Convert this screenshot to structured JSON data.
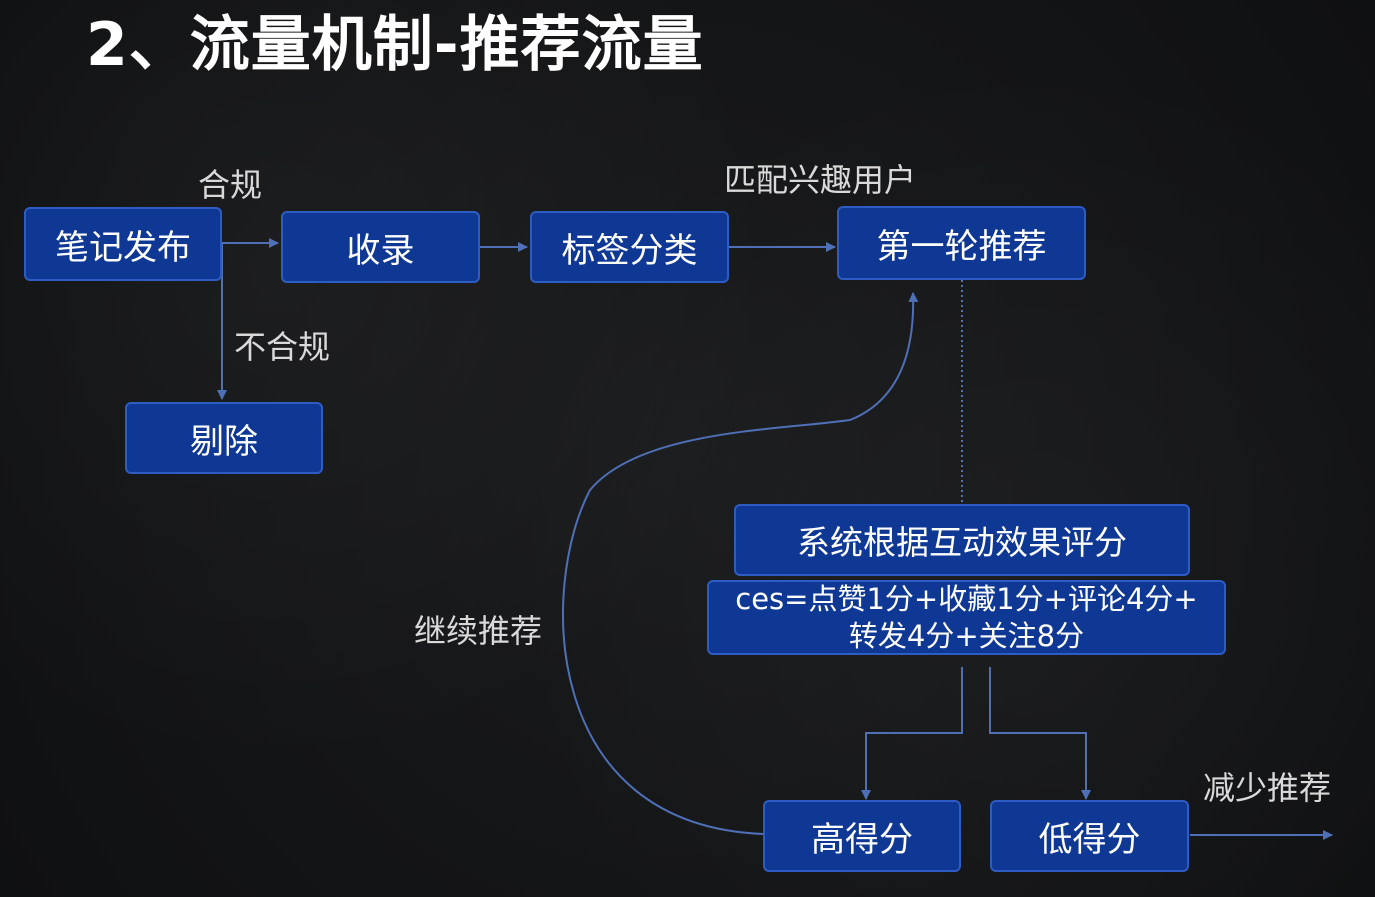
{
  "slide": {
    "title": "2、流量机制-推荐流量"
  },
  "nodes": {
    "publish": "笔记发布",
    "include": "收录",
    "tag_classify": "标签分类",
    "first_round": "第一轮推荐",
    "remove": "剔除",
    "system_score": "系统根据互动效果评分",
    "formula_line1": "ces=点赞1分+收藏1分+评论4分+",
    "formula_line2": "转发4分+关注8分",
    "high_score": "高得分",
    "low_score": "低得分"
  },
  "edge_labels": {
    "compliant": "合规",
    "non_compliant": "不合规",
    "match_users": "匹配兴趣用户",
    "continue_recommend": "继续推荐",
    "reduce_recommend": "减少推荐"
  },
  "colors": {
    "background": "#111213",
    "node_fill": "#0f3894",
    "node_border": "#2d5dc2",
    "connector": "#4f6fb6",
    "title_text": "#ffffff",
    "label_text": "#d9d9d9"
  }
}
